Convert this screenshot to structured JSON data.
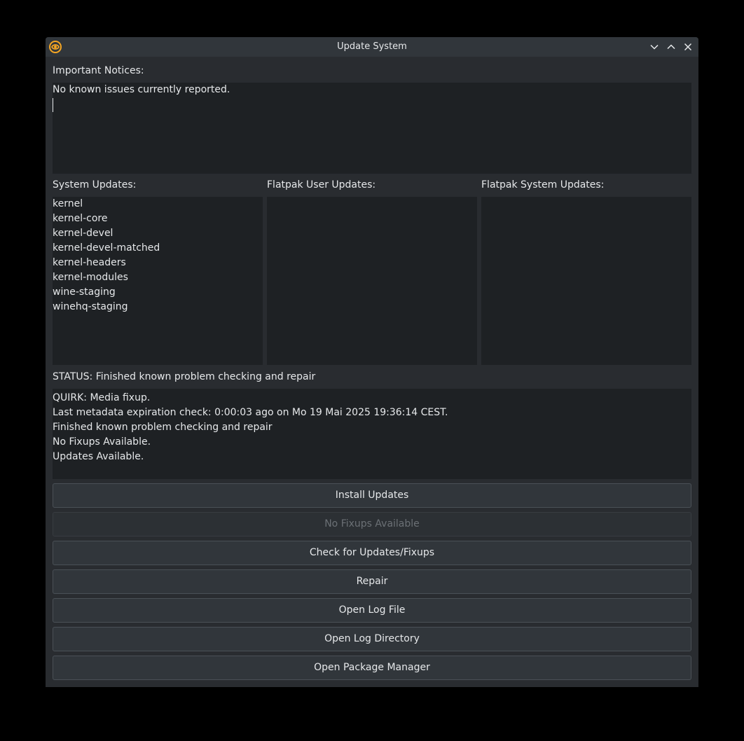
{
  "window": {
    "title": "Update System",
    "app_icon": "nobara-logo-icon",
    "controls": [
      "minimize-icon",
      "maximize-icon",
      "close-icon"
    ]
  },
  "notices": {
    "label": "Important Notices:",
    "text": "No known issues currently reported."
  },
  "system_updates": {
    "label": "System Updates:",
    "items": [
      "kernel",
      "kernel-core",
      "kernel-devel",
      "kernel-devel-matched",
      "kernel-headers",
      "kernel-modules",
      "wine-staging",
      "winehq-staging"
    ]
  },
  "flatpak_user_updates": {
    "label": "Flatpak User Updates:",
    "items": []
  },
  "flatpak_system_updates": {
    "label": "Flatpak System Updates:",
    "items": []
  },
  "status": {
    "label": "STATUS: Finished known problem checking and repair",
    "log_lines": [
      "QUIRK: Media fixup.",
      "Last metadata expiration check: 0:00:03 ago on Mo 19 Mai 2025 19:36:14 CEST.",
      "Finished known problem checking and repair",
      "No Fixups Available.",
      "Updates Available."
    ]
  },
  "buttons": {
    "install": "Install Updates",
    "fixups": "No Fixups Available",
    "check": "Check for Updates/Fixups",
    "repair": "Repair",
    "open_log_file": "Open Log File",
    "open_log_directory": "Open Log Directory",
    "open_package_manager": "Open Package Manager"
  },
  "colors": {
    "window_bg": "#292c30",
    "panel_bg": "#1e2124",
    "button_bg": "#31363b",
    "icon_accent": "#f5a623"
  }
}
